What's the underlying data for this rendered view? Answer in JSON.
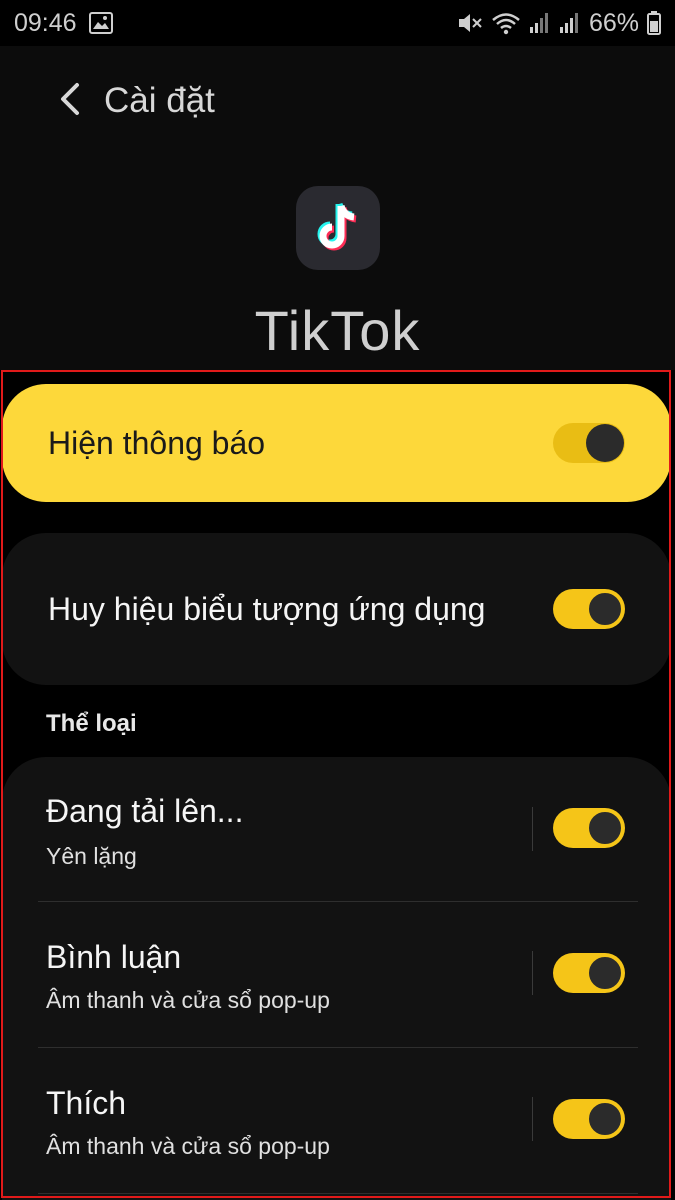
{
  "status_bar": {
    "time": "09:46",
    "battery": "66%",
    "icons": [
      "image-icon",
      "mute-icon",
      "wifi-icon",
      "signal-icon",
      "signal-icon",
      "battery-icon"
    ]
  },
  "header": {
    "back_icon": "chevron-left-icon",
    "title": "Cài đặt"
  },
  "app": {
    "name": "TikTok",
    "icon": "tiktok-logo"
  },
  "settings": {
    "show_notifications": {
      "label": "Hiện thông báo",
      "enabled": true
    },
    "app_icon_badge": {
      "label": "Huy hiệu biểu tượng ứng dụng",
      "enabled": true
    }
  },
  "categories": {
    "title": "Thể loại",
    "items": [
      {
        "title": "Đang tải lên...",
        "subtitle": "Yên lặng",
        "enabled": true
      },
      {
        "title": "Bình luận",
        "subtitle": "Âm thanh và cửa sổ pop-up",
        "enabled": true
      },
      {
        "title": "Thích",
        "subtitle": "Âm thanh và cửa sổ pop-up",
        "enabled": true
      }
    ]
  },
  "colors": {
    "accent": "#fdd83a",
    "toggle_on": "#f5c518",
    "highlight_frame": "#e11a1a",
    "background": "#000000",
    "card": "#121212"
  }
}
